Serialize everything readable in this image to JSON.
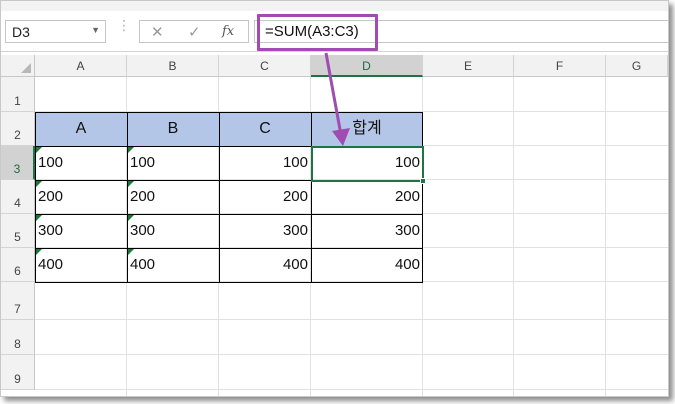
{
  "formula_bar": {
    "name_box": "D3",
    "cancel_icon": "✕",
    "enter_icon": "✓",
    "fx_icon": "fx",
    "formula": "=SUM(A3:C3)"
  },
  "columns": [
    "A",
    "B",
    "C",
    "D",
    "E",
    "F",
    "G"
  ],
  "rows": [
    "1",
    "2",
    "3",
    "4",
    "5",
    "6",
    "7",
    "8",
    "9"
  ],
  "table": {
    "headers": [
      "A",
      "B",
      "C",
      "합계"
    ],
    "data": [
      [
        "100",
        "100",
        "100",
        "100"
      ],
      [
        "200",
        "200",
        "200",
        "200"
      ],
      [
        "300",
        "300",
        "300",
        "300"
      ],
      [
        "400",
        "400",
        "400",
        "400"
      ]
    ]
  },
  "colors": {
    "header_fill": "#b4c6e7",
    "selection": "#217346",
    "annotation": "#a04cb0"
  }
}
